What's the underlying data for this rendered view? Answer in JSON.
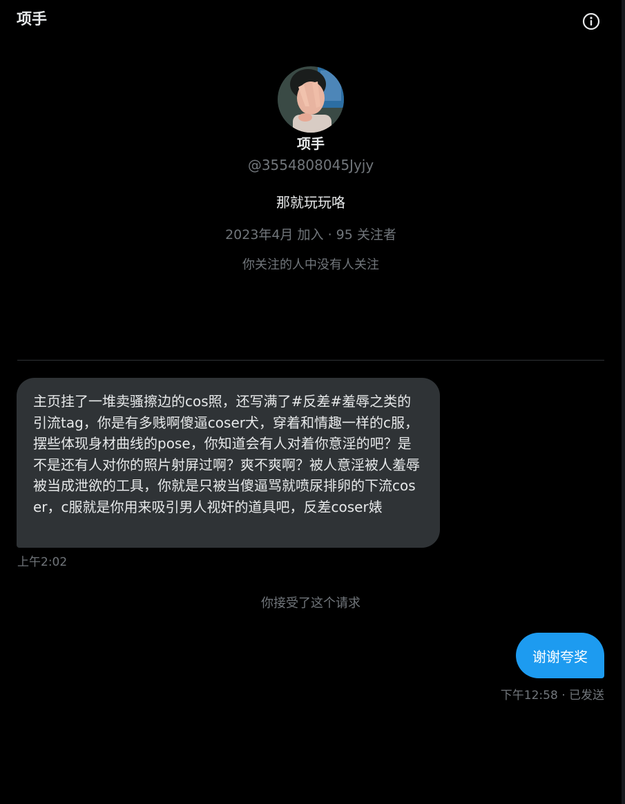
{
  "header": {
    "title": "项手",
    "info_icon": "info-circle-icon"
  },
  "profile": {
    "name": "项手",
    "handle": "@3554808045Jyjy",
    "bio": "那就玩玩咯",
    "meta": "2023年4月 加入 · 95 关注者",
    "followers_note": "你关注的人中没有人关注"
  },
  "conversation": {
    "incoming": {
      "text": "主页挂了一堆卖骚擦边的cos照，还写满了#反差#羞辱之类的引流tag，你是有多贱啊傻逼coser犬，穿着和情趣一样的c服，摆些体现身材曲线的pose，你知道会有人对着你意淫的吧？是不是还有人对你的照片射屏过啊？爽不爽啊？被人意淫被人羞辱被当成泄欲的工具，你就是只被当傻逼骂就喷尿排卵的下流coser，c服就是你用来吸引男人视奸的道具吧，反差coser婊",
      "time": "上午2:02"
    },
    "system_note": "你接受了这个请求",
    "outgoing": {
      "text": "谢谢夸奖",
      "meta": "下午12:58 · 已发送"
    }
  },
  "colors": {
    "background": "#000000",
    "text_primary": "#e7e9ea",
    "text_secondary": "#71767b",
    "incoming_bubble": "#2f3336",
    "outgoing_bubble": "#1d9bf0",
    "divider": "#2f3336"
  }
}
